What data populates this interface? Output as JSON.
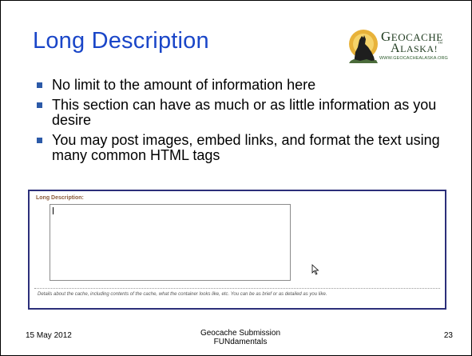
{
  "slide": {
    "title": "Long Description",
    "logo": {
      "line1_big": "G",
      "line1_rest": "EOCACHE",
      "line2_big": "A",
      "line2_rest": "LASKA!",
      "line2_mark": "™",
      "url": "WWW.GEOCACHEALASKA.ORG",
      "icon": "howling-wolf-icon"
    },
    "bullets": [
      "No limit to the amount of information here",
      "This section can have as much or as little information as you desire",
      "You may post images, embed links, and format the text using many common HTML tags"
    ],
    "screenshot": {
      "label": "Long Description:",
      "textarea_value": "",
      "help_text": "Details about the cache, including contents of the cache, what the container looks like, etc. You can be as brief or as detailed as you like."
    },
    "footer": {
      "date": "15 May 2012",
      "center_line1": "Geocache Submission",
      "center_line2": "FUNdamentals",
      "page_number": "23"
    }
  },
  "colors": {
    "title": "#1a46c8",
    "bullet": "#2c5aa8",
    "screenshot_border": "#2c2f7a",
    "field_label": "#8a5a3a"
  }
}
